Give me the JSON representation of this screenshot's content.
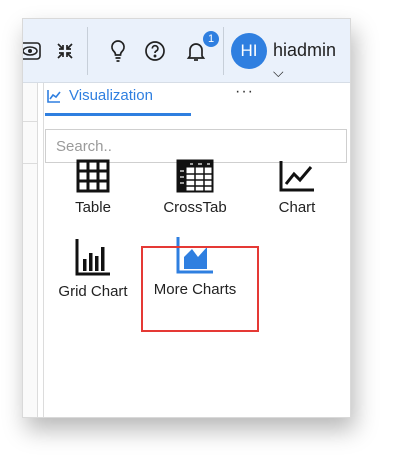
{
  "header": {
    "notification_count": "1",
    "avatar_initials": "HI",
    "username": "hiadmin"
  },
  "panel": {
    "tab_label": "Visualization",
    "more_label": "···",
    "search_placeholder": "Search.."
  },
  "visualizations": [
    {
      "label": "Table",
      "icon": "table-icon"
    },
    {
      "label": "CrossTab",
      "icon": "crosstab-icon"
    },
    {
      "label": "Chart",
      "icon": "line-chart-icon"
    },
    {
      "label": "Grid Chart",
      "icon": "bar-chart-icon"
    },
    {
      "label": "More Charts",
      "icon": "area-chart-icon",
      "highlighted": true
    }
  ],
  "colors": {
    "accent": "#2f7fe0",
    "highlight": "#e53935",
    "topbar": "#eaf1fb"
  }
}
